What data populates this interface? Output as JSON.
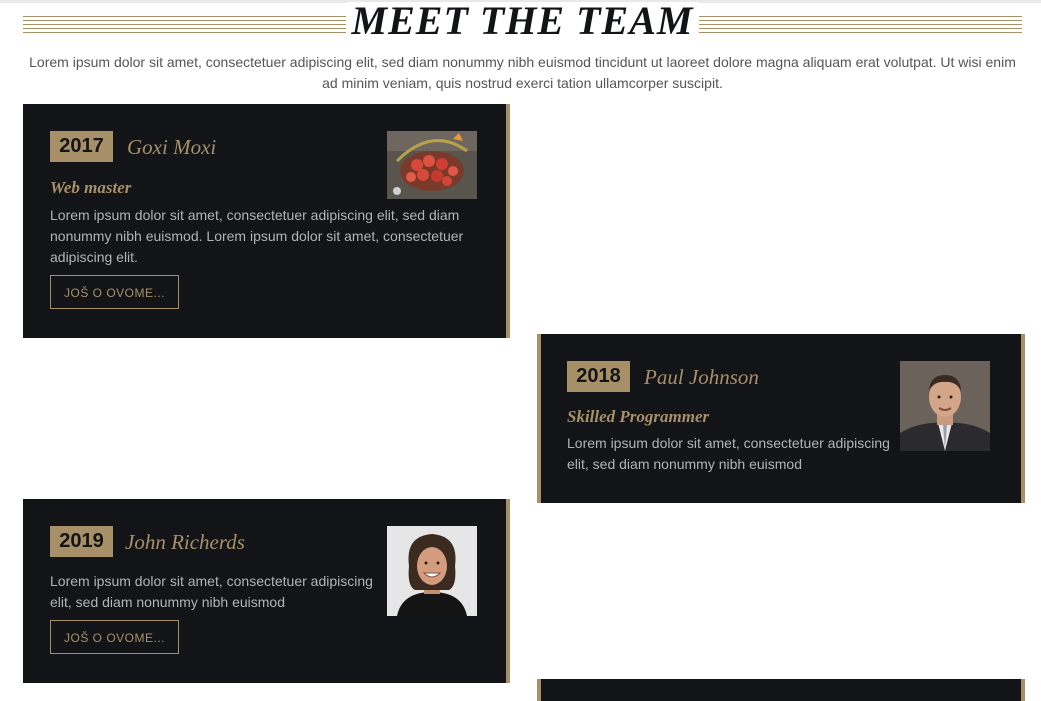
{
  "page": {
    "title": "MEET THE TEAM",
    "intro": "Lorem ipsum dolor sit amet, consectetuer adipiscing elit, sed diam nonummy nibh euismod tincidunt ut laoreet dolore magna aliquam erat volutpat. Ut wisi enim ad minim veniam, quis nostrud exerci tation ullamcorper suscipit."
  },
  "colors": {
    "accent": "#a79068",
    "card_bg": "#121418",
    "text_muted": "#b3b3b3"
  },
  "team": [
    {
      "year": "2017",
      "name": "Goxi Moxi",
      "role": "Web master",
      "description": "Lorem ipsum dolor sit amet, consectetuer adipiscing elit, sed diam nonummy nibh euismod. Lorem ipsum dolor sit amet, consectetuer adipiscing elit.",
      "button": "JOŠ O OVOME...",
      "photo": "flower-basket-image"
    },
    {
      "year": "2018",
      "name": "Paul Johnson",
      "role": "Skilled Programmer",
      "description": "Lorem ipsum dolor sit amet, consectetuer adipiscing elit, sed diam nonummy nibh euismod",
      "photo": "man-in-suit-portrait"
    },
    {
      "year": "2019",
      "name": "John Richerds",
      "description": "Lorem ipsum dolor sit amet, consectetuer adipiscing elit, sed diam nonummy nibh euismod",
      "button": "JOŠ O OVOME...",
      "photo": "smiling-man-portrait"
    }
  ]
}
